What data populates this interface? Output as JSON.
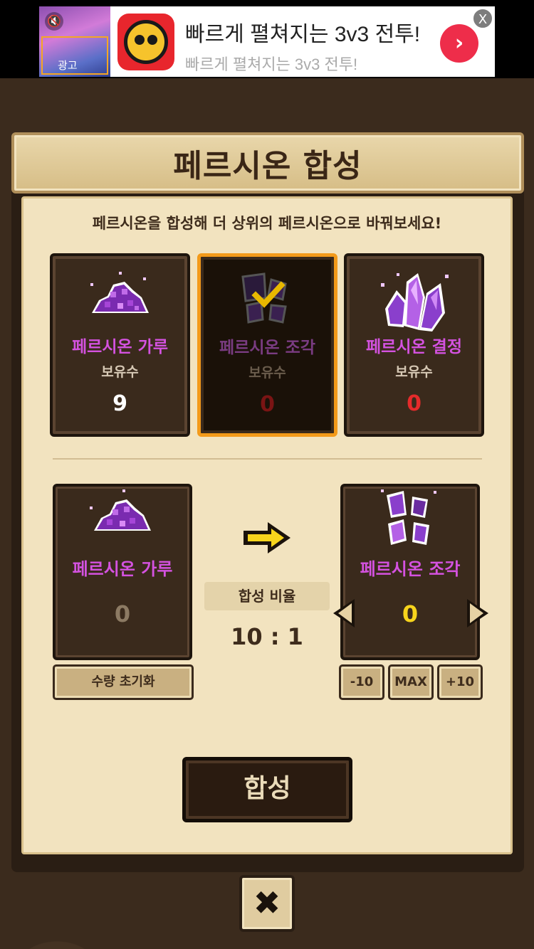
{
  "ad": {
    "title": "빠르게 펼쳐지는 3v3 전투!",
    "subtitle": "빠르게 펼쳐지는 3v3 전투!",
    "thumb_tag": "광고",
    "close_label": "X",
    "go_icon": "chevron-right-icon",
    "mute_icon": "speaker-muted-icon"
  },
  "panel": {
    "title": "페르시온 합성",
    "subtitle": "페르시온을 합성해 더 상위의 페르시온으로 바꿔보세요!"
  },
  "inventory": [
    {
      "name": "페르시온 가루",
      "hold_label": "보유수",
      "count": "9",
      "selected": false
    },
    {
      "name": "페르시온 조각",
      "hold_label": "보유수",
      "count": "0",
      "selected": true
    },
    {
      "name": "페르시온 결정",
      "hold_label": "보유수",
      "count": "0",
      "selected": false
    }
  ],
  "synthesis": {
    "source": {
      "name": "페르시온 가루",
      "count": "0"
    },
    "target": {
      "name": "페르시온 조각",
      "count": "0"
    },
    "ratio_label": "합성 비율",
    "ratio_value": "10 : 1",
    "reset_label": "수량 초기화",
    "minus_label": "-10",
    "max_label": "MAX",
    "plus_label": "+10",
    "compose_label": "합성"
  },
  "close_icon": "close-x-icon",
  "colors": {
    "accent_purple": "#d452e0",
    "selected_border": "#f39a1a",
    "zero_red": "#e52b2b",
    "target_yellow": "#f7d41c"
  }
}
